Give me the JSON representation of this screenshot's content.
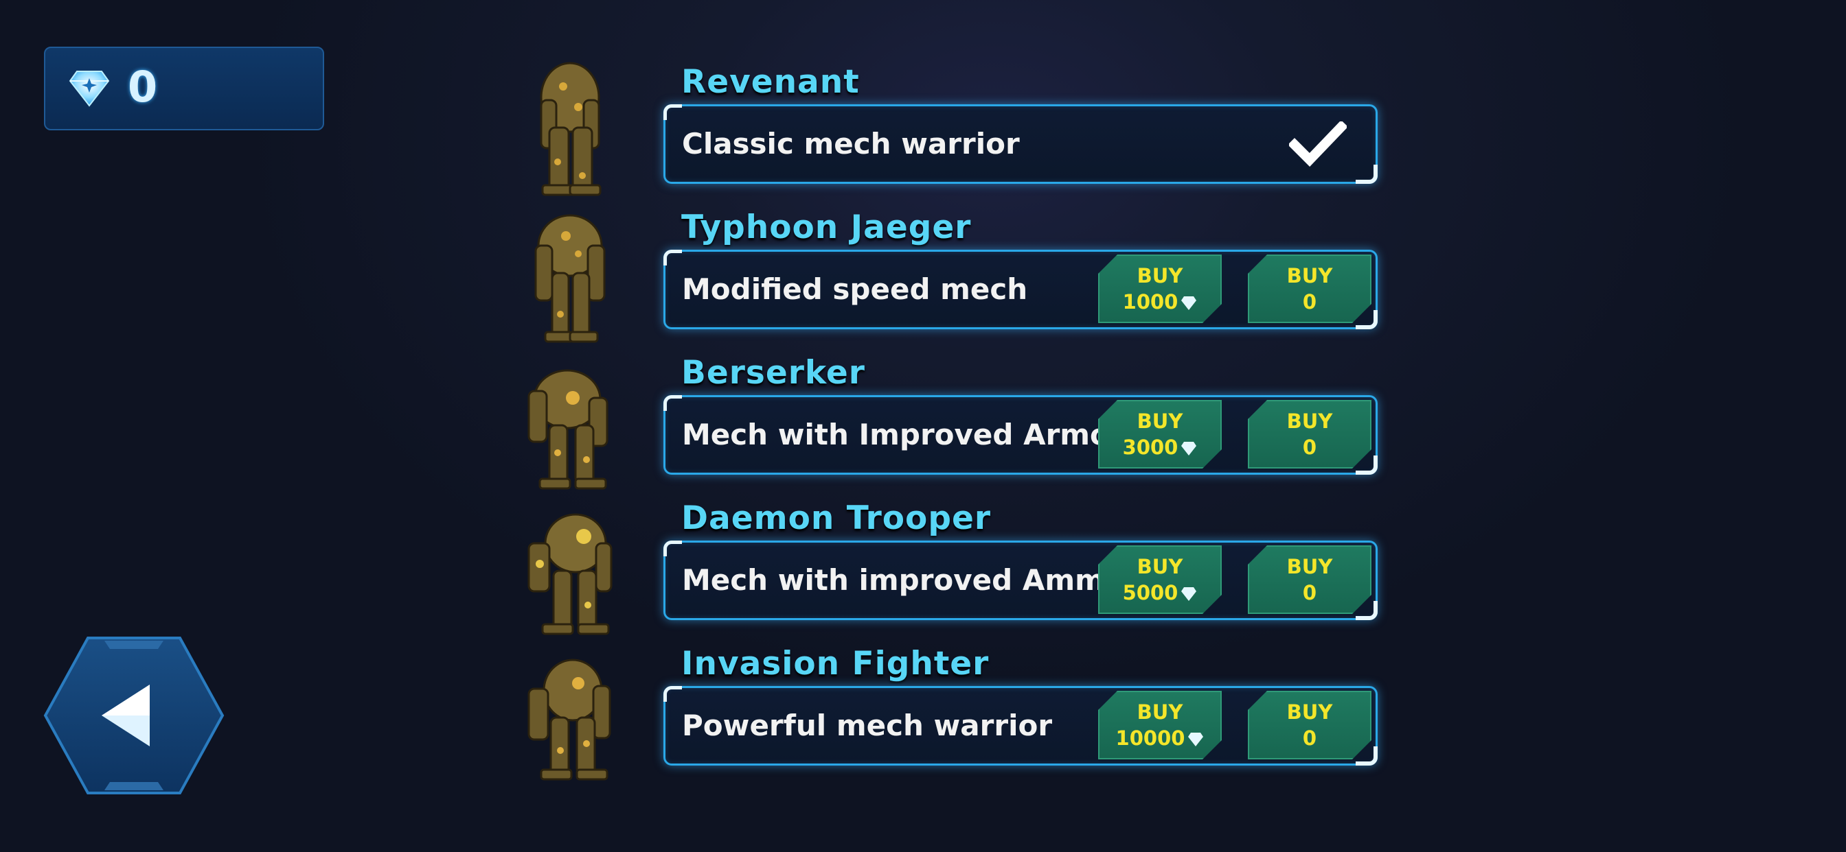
{
  "currency": {
    "gems": "0"
  },
  "mechs": [
    {
      "name": "Revenant",
      "description": "Classic mech warrior",
      "owned": true
    },
    {
      "name": "Typhoon Jaeger",
      "description": "Modified speed mech",
      "owned": false,
      "buy_label": "BUY",
      "gem_price": "1000",
      "coin_price": "0"
    },
    {
      "name": "Berserker",
      "description": "Mech with Improved Armor",
      "owned": false,
      "buy_label": "BUY",
      "gem_price": "3000",
      "coin_price": "0"
    },
    {
      "name": "Daemon Trooper",
      "description": "Mech with improved Ammo",
      "owned": false,
      "buy_label": "BUY",
      "gem_price": "5000",
      "coin_price": "0"
    },
    {
      "name": "Invasion Fighter",
      "description": "Powerful mech warrior",
      "owned": false,
      "buy_label": "BUY",
      "gem_price": "10000",
      "coin_price": "0"
    }
  ],
  "colors": {
    "title": "#58d6f6",
    "buy_text": "#f4e62a",
    "buy_bg": "#1f7a60",
    "panel_border": "#2aa8e8"
  },
  "icons": {
    "currency": "diamond-icon",
    "owned": "checkmark-icon",
    "back": "back-arrow-icon"
  }
}
